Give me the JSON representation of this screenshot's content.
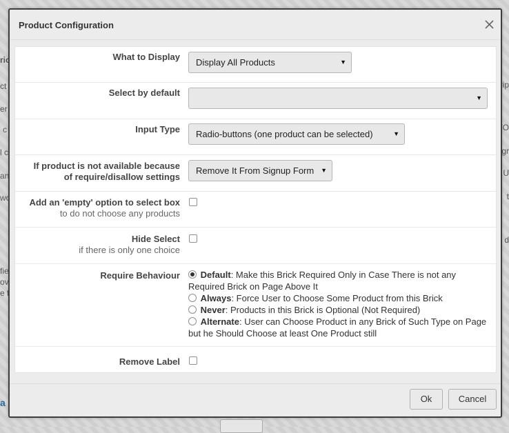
{
  "background": {
    "fragments_left": [
      "ric",
      "ct",
      "er",
      "c",
      "l c",
      "an",
      "wo",
      "fie",
      "ove",
      "e f",
      "a"
    ],
    "fragments_right": [
      "rip",
      "TO",
      "gr",
      "U",
      "t",
      "d"
    ]
  },
  "dialog": {
    "title": "Product Configuration",
    "close_icon": "close-icon"
  },
  "form": {
    "what_to_display": {
      "label": "What to Display",
      "value": "Display All Products"
    },
    "select_by_default": {
      "label": "Select by default",
      "value": ""
    },
    "input_type": {
      "label": "Input Type",
      "value": "Radio-buttons (one product can be selected)"
    },
    "not_available": {
      "label_line1": "If product is not available because",
      "label_line2": "of require/disallow settings",
      "value": "Remove It From Signup Form"
    },
    "empty_option": {
      "label": "Add an 'empty' option to select box",
      "sublabel": "to do not choose any products",
      "checked": false
    },
    "hide_select": {
      "label": "Hide Select",
      "sublabel": "if there is only one choice",
      "checked": false
    },
    "require_behaviour": {
      "label": "Require Behaviour",
      "options": [
        {
          "name": "Default",
          "text": ": Make this Brick Required Only in Case There is not any Required Brick on Page Above It",
          "checked": true
        },
        {
          "name": "Always",
          "text": ": Force User to Choose Some Product from this Brick",
          "checked": false
        },
        {
          "name": "Never",
          "text": ": Products in this Brick is Optional (Not Required)",
          "checked": false
        },
        {
          "name": "Alternate",
          "text": ": User can Choose Product in any Brick of Such Type on Page but he Should Choose at least One Product still",
          "checked": false
        }
      ]
    },
    "remove_label": {
      "label": "Remove Label",
      "checked": false
    }
  },
  "footer": {
    "ok_label": "Ok",
    "cancel_label": "Cancel"
  }
}
